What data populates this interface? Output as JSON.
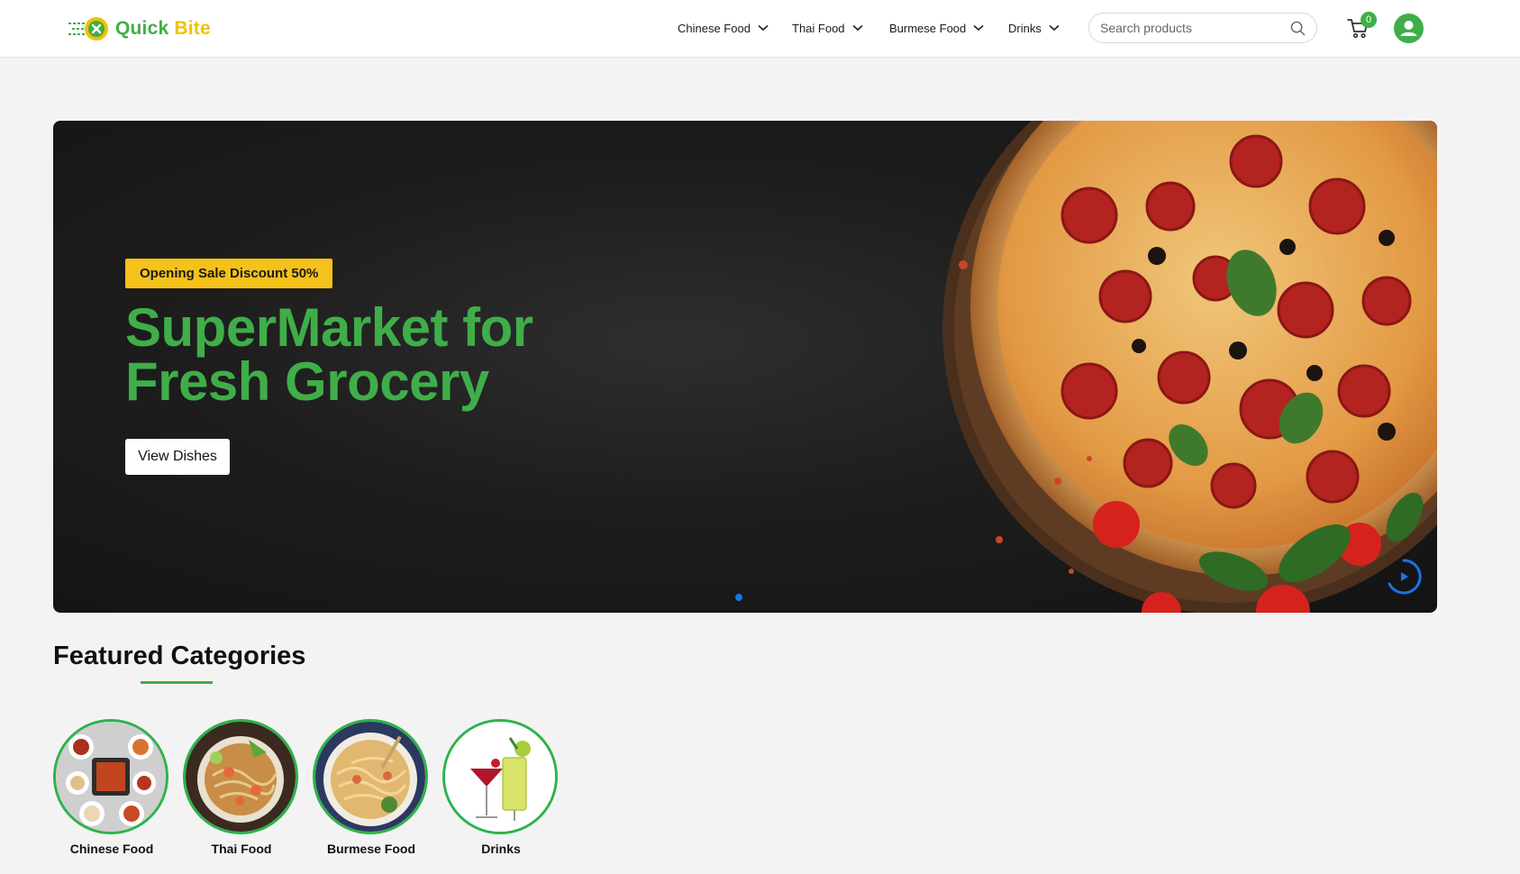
{
  "brand": {
    "name_part1": "Quick",
    "name_part2": "Bite",
    "primary_color": "#3fae49",
    "accent_color": "#f2c200"
  },
  "nav": [
    {
      "label": "Chinese Food",
      "icon": "chevron-down-icon"
    },
    {
      "label": "Thai Food",
      "icon": "chevron-down-icon"
    },
    {
      "label": "Burmese Food",
      "icon": "chevron-down-icon"
    },
    {
      "label": "Drinks",
      "icon": "chevron-down-icon"
    }
  ],
  "search": {
    "placeholder": "Search products",
    "value": "",
    "icon": "search-icon"
  },
  "cart": {
    "count": "0",
    "icon": "cart-icon"
  },
  "user": {
    "icon": "user-avatar-icon"
  },
  "hero": {
    "badge": "Opening Sale Discount 50%",
    "title_line1": "SuperMarket for",
    "title_line2": "Fresh Grocery",
    "button_label": "View Dishes",
    "slide_count": 1,
    "active_slide": 1,
    "badge_color": "#f4c21a",
    "dot_color": "#1a73e8"
  },
  "featured": {
    "title": "Featured Categories",
    "categories": [
      {
        "label": "Chinese Food"
      },
      {
        "label": "Thai Food"
      },
      {
        "label": "Burmese Food"
      },
      {
        "label": "Drinks"
      }
    ]
  }
}
